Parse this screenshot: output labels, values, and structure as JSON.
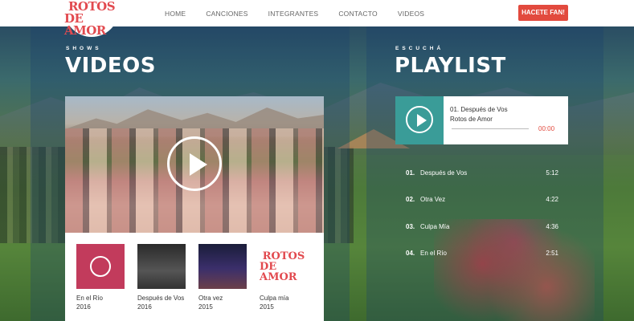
{
  "brand": {
    "logo_line1": "ROTOS",
    "logo_line2": "DE AMOR"
  },
  "nav": {
    "items": [
      "HOME",
      "CANCIONES",
      "INTEGRANTES",
      "CONTACTO",
      "VIDEOS"
    ],
    "cta": "HACETE FAN!"
  },
  "videos": {
    "kicker": "SHOWS",
    "title": "VIDEOS",
    "items": [
      {
        "title": "En el Río",
        "year": "2016"
      },
      {
        "title": "Después de Vos",
        "year": "2016"
      },
      {
        "title": "Otra vez",
        "year": "2015"
      },
      {
        "title": "Culpa mía",
        "year": "2015"
      }
    ],
    "thumb_logo_line1": "ROTOS",
    "thumb_logo_line2": "DE AMOR"
  },
  "playlist": {
    "kicker": "ESCUCHÁ",
    "title": "PLAYLIST",
    "now_playing": {
      "title": "01. Después de Vos",
      "artist": "Rotos de Amor",
      "time": "00:00"
    },
    "tracks": [
      {
        "num": "01.",
        "title": "Después de Vos",
        "duration": "5:12"
      },
      {
        "num": "02.",
        "title": "Otra Vez",
        "duration": "4:22"
      },
      {
        "num": "03.",
        "title": "Culpa Mía",
        "duration": "4:36"
      },
      {
        "num": "04.",
        "title": "En el Río",
        "duration": "2:51"
      }
    ]
  },
  "colors": {
    "accent": "#e24a3e",
    "brand_red": "#e24a4f",
    "player_teal": "#3a9c98"
  }
}
